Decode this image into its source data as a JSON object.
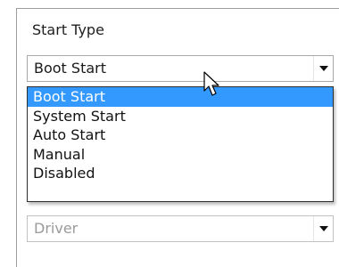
{
  "start_type": {
    "label": "Start Type",
    "selected_value": "Boot Start",
    "options": [
      "Boot Start",
      "System Start",
      "Auto Start",
      "Manual",
      "Disabled"
    ],
    "highlighted_option": "Boot Start"
  },
  "type_field": {
    "value": "Driver"
  },
  "icons": {
    "dropdown": "chevron-down-icon",
    "cursor": "mouse-pointer-icon"
  },
  "colors": {
    "selection": "#3399ff",
    "disabled_text": "#9a9a9a"
  }
}
